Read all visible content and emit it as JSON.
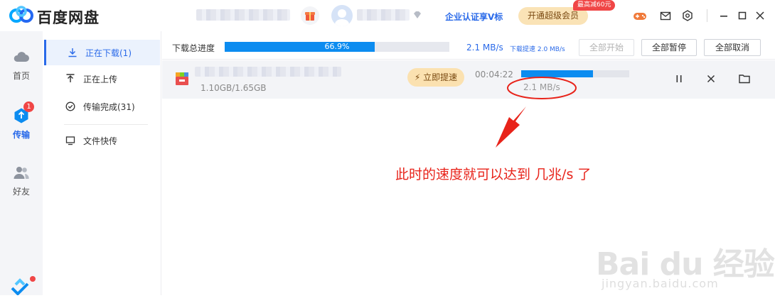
{
  "app": {
    "title": "百度网盘"
  },
  "header": {
    "vip_link": "企业认证享V标",
    "upgrade_label": "开通超级会员",
    "promo_badge": "最高减60元"
  },
  "nav": {
    "items": [
      {
        "label": "首页",
        "icon": "cloud-icon"
      },
      {
        "label": "传输",
        "icon": "transfer-icon",
        "badge": "1"
      },
      {
        "label": "好友",
        "icon": "friends-icon"
      }
    ]
  },
  "sidebar": {
    "items": [
      {
        "label": "正在下载(1)",
        "icon": "download-icon",
        "active": true
      },
      {
        "label": "正在上传",
        "icon": "upload-icon"
      },
      {
        "label": "传输完成(31)",
        "icon": "check-circle-icon"
      },
      {
        "label": "文件快传",
        "icon": "monitor-icon"
      }
    ]
  },
  "summary": {
    "label": "下载总进度",
    "progress_text": "66.9%",
    "progress": 0.669,
    "speed": "2.1 MB/s",
    "speed_limit": "下载提速 2.0 MB/s",
    "buttons": {
      "start_all": "全部开始",
      "pause_all": "全部暂停",
      "cancel_all": "全部取消"
    }
  },
  "download": {
    "size": "1.10GB/1.65GB",
    "progress": 0.667,
    "speedup_label": "⚡ 立即提速",
    "eta": "00:04:22",
    "speed": "2.1 MB/s"
  },
  "annotation": {
    "text": "此时的速度就可以达到 几兆/s 了",
    "color": "#e8231a"
  },
  "watermark": {
    "main": "Bai du 经验",
    "sub": "jingyan.baidu.com"
  },
  "colors": {
    "accent": "#2a6ae9",
    "progress": "#0c8cf0",
    "annotation": "#e8231a"
  }
}
